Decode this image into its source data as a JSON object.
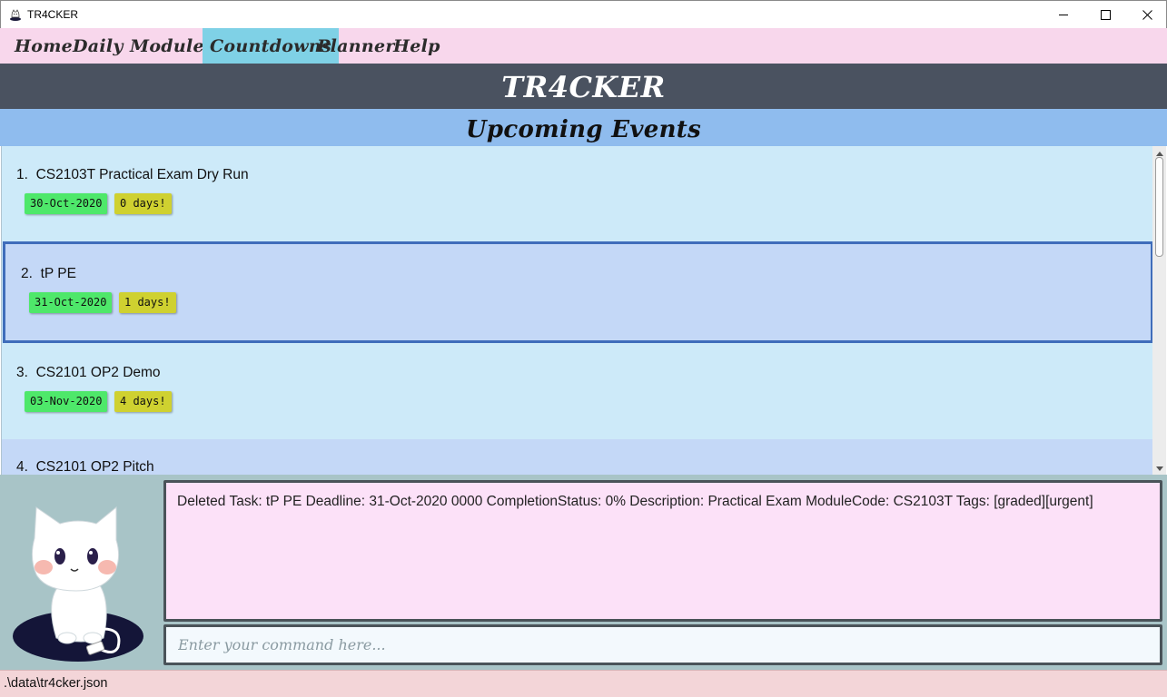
{
  "window": {
    "title": "TR4CKER",
    "buttons": [
      "minimize",
      "maximize",
      "close"
    ]
  },
  "menu": {
    "items": [
      {
        "label": "Home"
      },
      {
        "label": "Daily"
      },
      {
        "label": "Modules"
      },
      {
        "label": "Countdowns",
        "active": true
      },
      {
        "label": "Planner"
      },
      {
        "label": "Help"
      }
    ]
  },
  "header": {
    "title": "TR4CKER"
  },
  "section": {
    "title": "Upcoming Events"
  },
  "events": [
    {
      "index": "1.",
      "name": "CS2103T Practical Exam Dry Run",
      "date": "30-Oct-2020",
      "countdown": "0 days!"
    },
    {
      "index": "2.",
      "name": "tP PE",
      "date": "31-Oct-2020",
      "countdown": "1 days!",
      "selected": true
    },
    {
      "index": "3.",
      "name": "CS2101 OP2 Demo",
      "date": "03-Nov-2020",
      "countdown": "4 days!"
    },
    {
      "index": "4.",
      "name": "CS2101 OP2 Pitch"
    }
  ],
  "result": {
    "text": "Deleted Task: tP PE Deadline: 31-Oct-2020 0000 CompletionStatus: 0% Description: Practical Exam ModuleCode: CS2103T Tags: [graded][urgent]"
  },
  "command": {
    "placeholder": "Enter your command here..."
  },
  "status": {
    "path": ".\\data\\tr4cker.json"
  },
  "colors": {
    "menubar": "#f8d7ec",
    "menu_active": "#7fd1e6",
    "header": "#4a5260",
    "section": "#8fbcee",
    "date_tag": "#4ee86a",
    "days_tag": "#cfd130",
    "selected_border": "#3f6dbb"
  }
}
